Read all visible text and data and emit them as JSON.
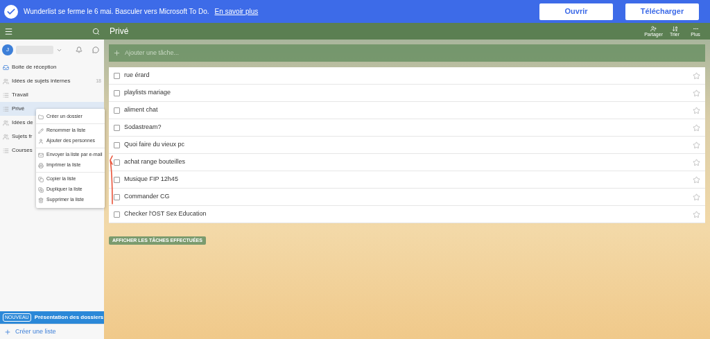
{
  "banner": {
    "text": "Wunderlist se ferme le 6 mai. Basculer vers Microsoft To Do.",
    "link": "En savoir plus",
    "buttons": [
      "Ouvrir",
      "Télécharger"
    ]
  },
  "sidebar": {
    "avatar": "J",
    "items": [
      {
        "label": "Boite de réception",
        "kind": "inbox",
        "selected": false
      },
      {
        "label": "Idées de sujets internes",
        "kind": "shared",
        "count": "18",
        "selected": false
      },
      {
        "label": "Travail",
        "kind": "list",
        "selected": false
      },
      {
        "label": "Privé",
        "kind": "list",
        "selected": true
      },
      {
        "label": "Idées de",
        "kind": "shared",
        "selected": false
      },
      {
        "label": "Sujets fr",
        "kind": "shared",
        "selected": false
      },
      {
        "label": "Courses",
        "kind": "list",
        "selected": false
      }
    ],
    "promo": {
      "badge": "NOUVEAU",
      "text": "Présentation des dossiers"
    },
    "create": "Créer une liste"
  },
  "context_menu": {
    "groups": [
      [
        {
          "label": "Créer un dossier",
          "kind": "folder"
        }
      ],
      [
        {
          "label": "Renommer la liste",
          "kind": "pencil"
        },
        {
          "label": "Ajouter des personnes",
          "kind": "person"
        }
      ],
      [
        {
          "label": "Envoyer la liste par e-mail",
          "kind": "mail"
        },
        {
          "label": "Imprimer la liste",
          "kind": "printer"
        }
      ],
      [
        {
          "label": "Copier la liste",
          "kind": "copy"
        },
        {
          "label": "Dupliquer la liste",
          "kind": "duplicate"
        },
        {
          "label": "Supprimer la liste",
          "kind": "trash"
        }
      ]
    ]
  },
  "main": {
    "title": "Privé",
    "toolbar": [
      {
        "label": "Partager",
        "kind": "share"
      },
      {
        "label": "Trier",
        "kind": "sort"
      },
      {
        "label": "Plus",
        "kind": "more"
      }
    ],
    "add_placeholder": "Ajouter une tâche...",
    "tasks": [
      {
        "title": "rue érard",
        "checked": false,
        "starred": false
      },
      {
        "title": "playlists mariage",
        "checked": false,
        "starred": false
      },
      {
        "title": "aliment chat",
        "checked": false,
        "starred": false
      },
      {
        "title": "Sodastream?",
        "checked": false,
        "starred": false
      },
      {
        "title": "Quoi faire du vieux pc",
        "checked": false,
        "starred": false
      },
      {
        "title": "achat range bouteilles",
        "checked": false,
        "starred": false
      },
      {
        "title": "Musique FIP 12h45",
        "checked": false,
        "starred": false
      },
      {
        "title": "Commander CG",
        "checked": false,
        "starred": false
      },
      {
        "title": "Checker l'OST Sex Education",
        "checked": false,
        "starred": false
      }
    ],
    "show_done": "AFFICHER LES TÂCHES EFFECTUÉES"
  }
}
